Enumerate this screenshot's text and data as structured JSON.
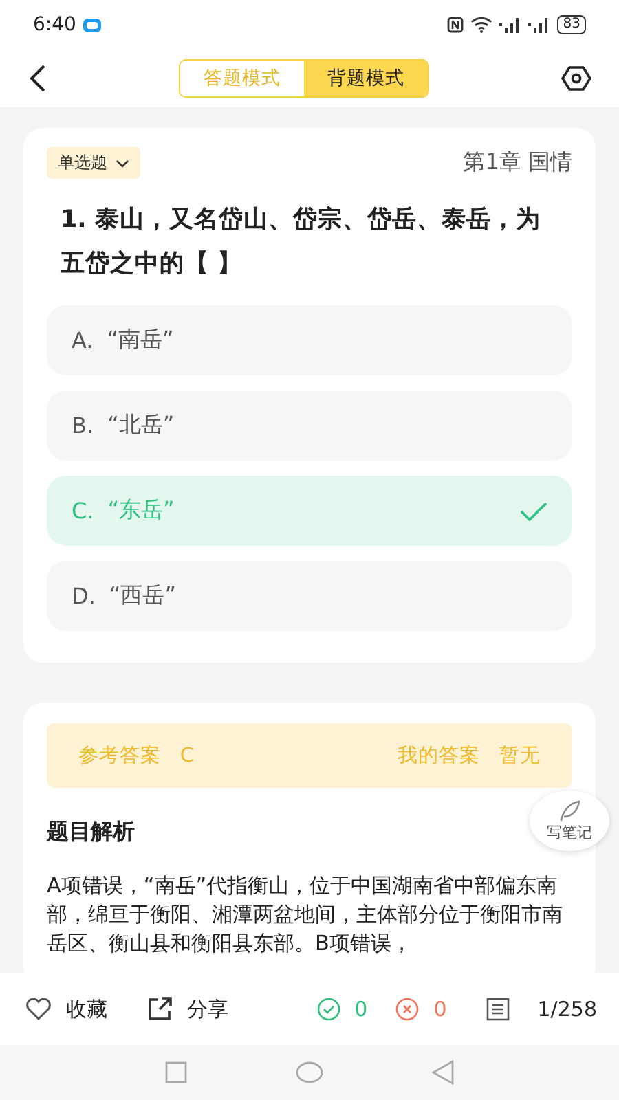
{
  "status_bar": {
    "time": "6:40",
    "battery": "83"
  },
  "header": {
    "modes": [
      {
        "label": "答题模式",
        "selected": false
      },
      {
        "label": "背题模式",
        "selected": true
      }
    ]
  },
  "question": {
    "type": "单选题",
    "chapter": "第1章 国情",
    "text": "1. 泰山，又名岱山、岱宗、岱岳、泰岳，为五岱之中的【 】",
    "options": [
      {
        "letter": "A.",
        "text": "“南岳”",
        "correct": false
      },
      {
        "letter": "B.",
        "text": "“北岳”",
        "correct": false
      },
      {
        "letter": "C.",
        "text": "“东岳”",
        "correct": true
      },
      {
        "letter": "D.",
        "text": "“西岳”",
        "correct": false
      }
    ]
  },
  "answer": {
    "reference_label": "参考答案",
    "reference": "C",
    "mine_label": "我的答案",
    "mine": "暂无"
  },
  "analysis": {
    "title": "题目解析",
    "text": "A项错误，“南岳”代指衡山，位于中国湖南省中部偏东南部，绵亘于衡阳、湘潭两盆地间，主体部分位于衡阳市南岳区、衡山县和衡阳县东部。B项错误，"
  },
  "note_button": "写笔记",
  "bottom_bar": {
    "favorite": "收藏",
    "share": "分享",
    "correct_count": "0",
    "wrong_count": "0",
    "progress": "1/258"
  }
}
